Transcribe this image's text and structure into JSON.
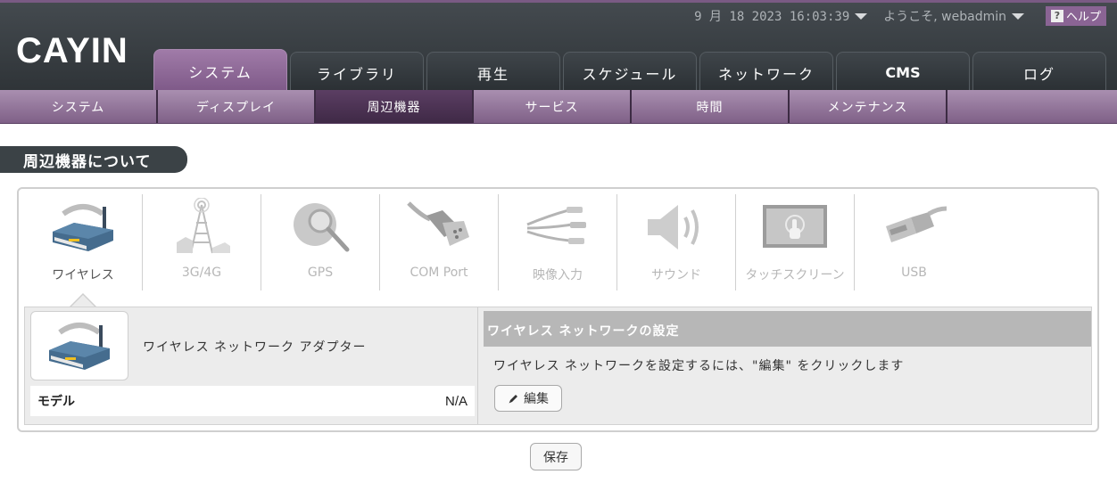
{
  "header": {
    "logo": "CAYIN",
    "datetime": "9 月 18 2023 16:03:39",
    "welcome": "ようこそ, webadmin",
    "help_label": "ヘルプ",
    "help_q": "?"
  },
  "main_tabs": [
    {
      "label": "システム",
      "active": true
    },
    {
      "label": "ライブラリ"
    },
    {
      "label": "再生"
    },
    {
      "label": "スケジュール"
    },
    {
      "label": "ネットワーク"
    },
    {
      "label": "CMS"
    },
    {
      "label": "ログ"
    }
  ],
  "sub_tabs": [
    {
      "label": "システム"
    },
    {
      "label": "ディスプレイ"
    },
    {
      "label": "周辺機器",
      "active": true
    },
    {
      "label": "サービス"
    },
    {
      "label": "時間"
    },
    {
      "label": "メンテナンス"
    }
  ],
  "section_title": "周辺機器について",
  "devices": [
    {
      "label": "ワイヤレス",
      "icon": "router-icon",
      "active": true
    },
    {
      "label": "3G/4G",
      "icon": "antenna-tower-icon"
    },
    {
      "label": "GPS",
      "icon": "globe-magnifier-icon"
    },
    {
      "label": "COM Port",
      "icon": "serial-cable-icon"
    },
    {
      "label": "映像入力",
      "icon": "av-cable-icon"
    },
    {
      "label": "サウンド",
      "icon": "speaker-icon"
    },
    {
      "label": "タッチスクリーン",
      "icon": "touchscreen-icon"
    },
    {
      "label": "USB",
      "icon": "usb-plug-icon"
    }
  ],
  "detail": {
    "adapter_name": "ワイヤレス ネットワーク アダプター",
    "model_key": "モデル",
    "model_value": "N/A",
    "settings_title": "ワイヤレス ネットワークの設定",
    "settings_desc": "ワイヤレス ネットワークを設定するには、\"編集\" をクリックします",
    "edit_label": "編集"
  },
  "save_label": "保存",
  "colors": {
    "accent_purple": "#8a6494",
    "header_dark": "#3a4045",
    "section_dark": "#3b4246"
  }
}
